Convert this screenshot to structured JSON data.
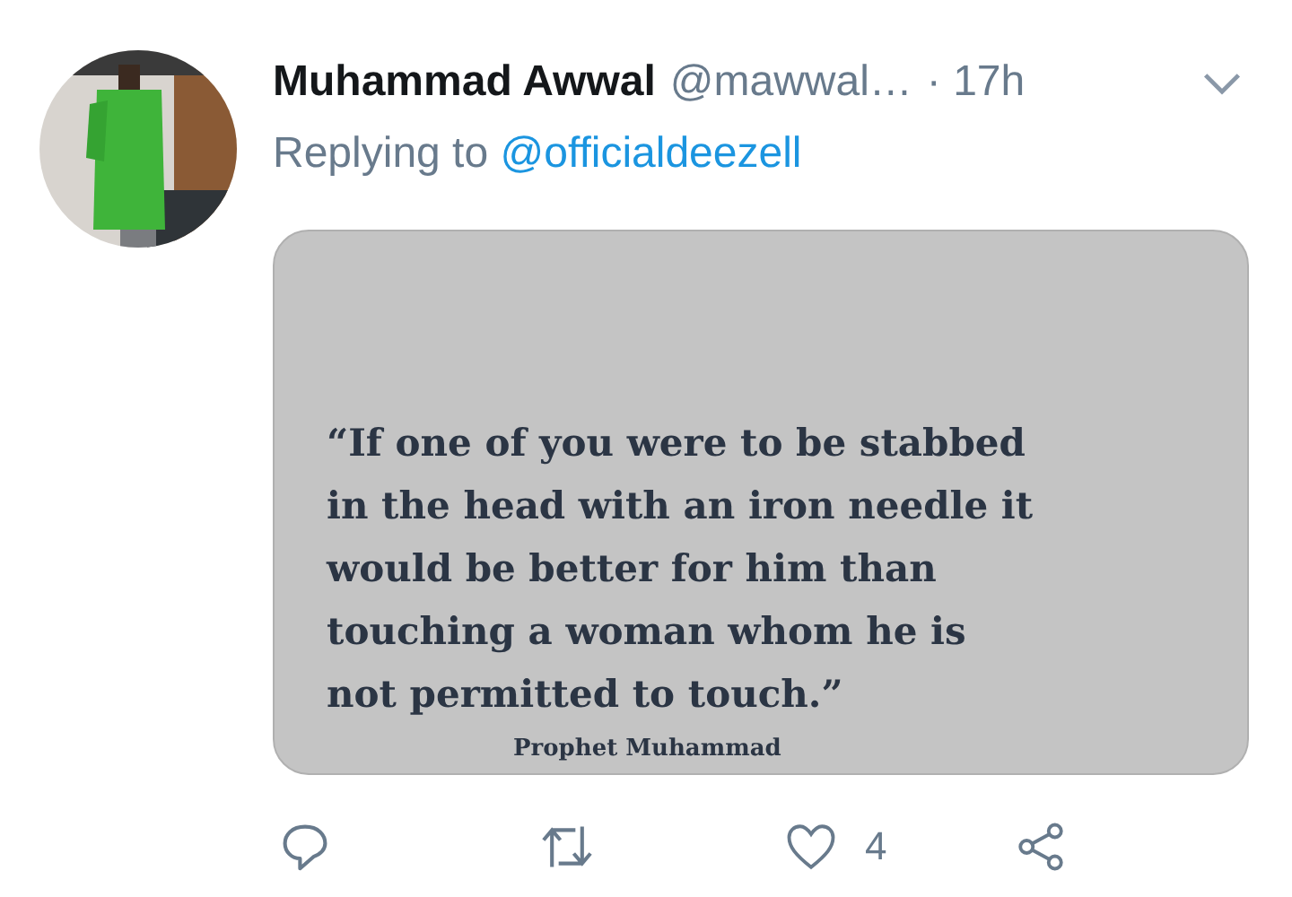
{
  "tweet": {
    "author_name": "Muhammad Awwal",
    "handle": "@mawwal…",
    "time": "· 17h",
    "reply_prefix": "Replying to",
    "reply_to": "@officialdeezell",
    "image": {
      "quote": "“If one of you were to be stabbed\nin the head with an iron needle it\nwould be better for him than\ntouching a woman whom he is\nnot permitted to touch.”",
      "attribution": "Prophet Muhammad"
    },
    "actions": {
      "like_count": "4"
    }
  }
}
